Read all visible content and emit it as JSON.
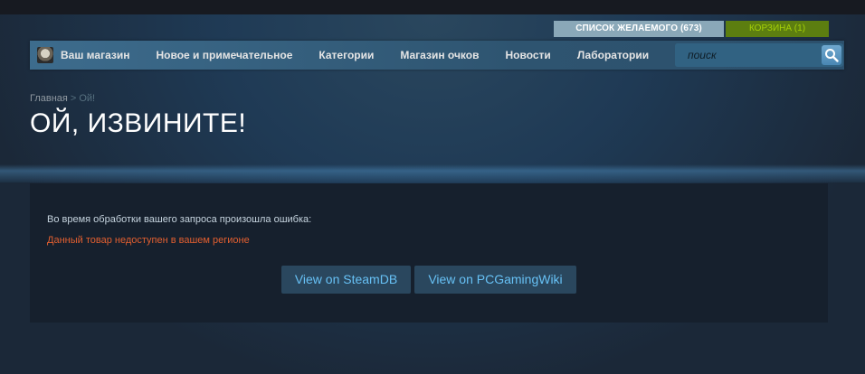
{
  "header": {
    "wishlist_label": "СПИСОК ЖЕЛАЕМОГО (673)",
    "cart_label": "КОРЗИНА (1)"
  },
  "nav": {
    "store_label": "Ваш магазин",
    "items": [
      {
        "label": "Новое и примечательное"
      },
      {
        "label": "Категории"
      },
      {
        "label": "Магазин очков"
      },
      {
        "label": "Новости"
      },
      {
        "label": "Лаборатории"
      }
    ],
    "search_placeholder": "поиск"
  },
  "breadcrumb": {
    "home": "Главная",
    "separator": ">",
    "current": "Ой!"
  },
  "page_title": "ОЙ, ИЗВИНИТЕ!",
  "error": {
    "message": "Во время обработки вашего запроса произошла ошибка:",
    "reason": "Данный товар недоступен в вашем регионе"
  },
  "buttons": {
    "steamdb": "View on SteamDB",
    "pcgamingwiki": "View on PCGamingWiki"
  },
  "colors": {
    "background": "#1b2838",
    "nav": "#3d6c8d",
    "cart": "#5c7e10",
    "cart_text": "#a4d007",
    "error_reason": "#e25f30",
    "link": "#67c1f5"
  }
}
